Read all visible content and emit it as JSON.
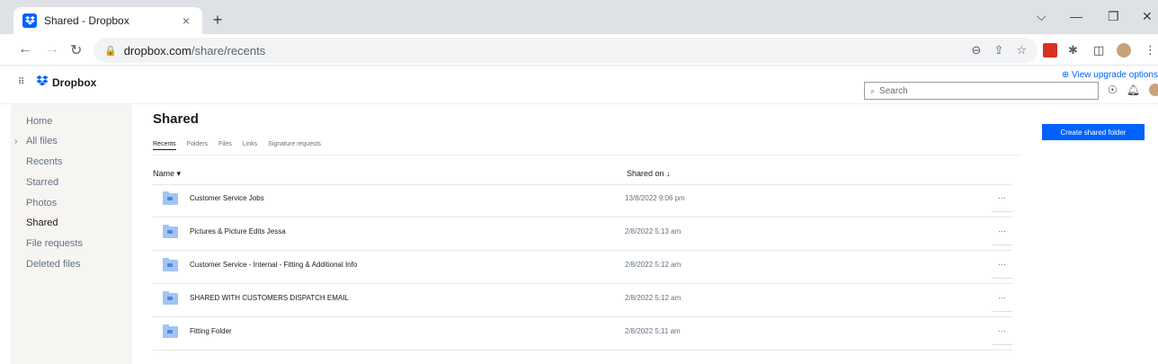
{
  "browser": {
    "tab_title": "Shared - Dropbox",
    "tab_close": "×",
    "new_tab": "+",
    "url_host": "dropbox.com",
    "url_path": "/share/recents",
    "win_min": "—",
    "win_restore": "❐",
    "win_close": "✕",
    "win_chevron": "⌵"
  },
  "header": {
    "brand": "Dropbox",
    "upgrade_link": "⊕ View upgrade options",
    "search_placeholder": "Search"
  },
  "sidebar": {
    "items": [
      {
        "label": "Home"
      },
      {
        "label": "All files"
      },
      {
        "label": "Recents"
      },
      {
        "label": "Starred"
      },
      {
        "label": "Photos"
      },
      {
        "label": "Shared"
      },
      {
        "label": "File requests"
      },
      {
        "label": "Deleted files"
      }
    ]
  },
  "main": {
    "title": "Shared",
    "tabs": [
      "Recents",
      "Folders",
      "Files",
      "Links",
      "Signature requests"
    ],
    "create_button": "Create shared folder",
    "col_name": "Name ▾",
    "col_shared": "Shared on ↓",
    "rows": [
      {
        "name": "Customer Service Jobs",
        "date": "13/8/2022 9:06 pm",
        "more": "···"
      },
      {
        "name": "Pictures & Picture Edits Jessa",
        "date": "2/8/2022 5:13 am",
        "more": "···"
      },
      {
        "name": "Customer Service - Internal - Fitting & Additional Info",
        "date": "2/8/2022 5:12 am",
        "more": "···"
      },
      {
        "name": "SHARED WITH CUSTOMERS DISPATCH EMAIL",
        "date": "2/8/2022 5:12 am",
        "more": "···"
      },
      {
        "name": "Fitting Folder",
        "date": "2/8/2022 5:11 am",
        "more": "···"
      }
    ]
  },
  "colors": {
    "accent": "#0061fe",
    "sidebar_bg": "#f7f5f2",
    "folder": "#a3c4f3"
  }
}
